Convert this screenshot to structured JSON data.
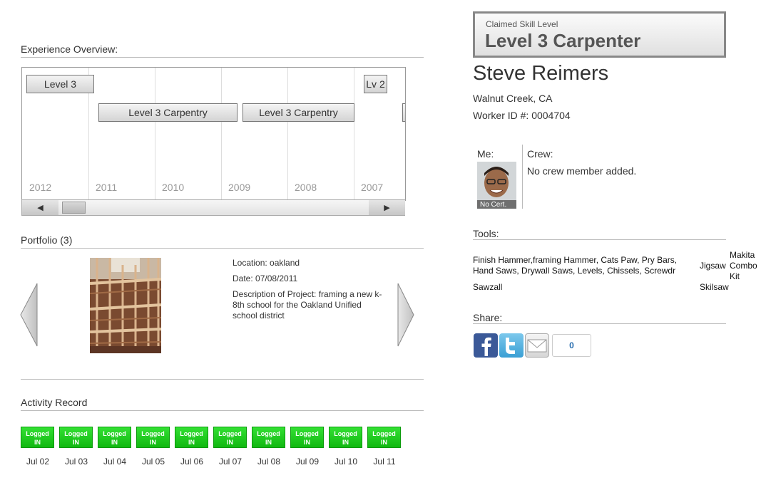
{
  "experience": {
    "title": "Experience Overview:",
    "years": [
      "2012",
      "2011",
      "2010",
      "2009",
      "2008",
      "2007"
    ],
    "bars": [
      "Level 3",
      "Level 3 Carpentry",
      "Level 3 Carpentry",
      "Lv 2"
    ],
    "scroll_left": "◀",
    "scroll_right": "▶"
  },
  "portfolio": {
    "title": "Portfolio (3)",
    "location": "Location: oakland",
    "date": "Date: 07/08/2011",
    "description": "Description of Project: framing a new k-8th school for the Oakland Unified school district"
  },
  "activity": {
    "title": "Activity Record",
    "badge_line1": "Logged",
    "badge_line2": "IN",
    "dates": [
      "Jul 02",
      "Jul 03",
      "Jul 04",
      "Jul 05",
      "Jul 06",
      "Jul 07",
      "Jul 08",
      "Jul 09",
      "Jul 10",
      "Jul 11"
    ]
  },
  "profile": {
    "skill_caption": "Claimed Skill Level",
    "skill_level": "Level 3 Carpenter",
    "name": "Steve Reimers",
    "location": "Walnut Creek, CA",
    "worker_id": "Worker ID #: 0004704",
    "me_label": "Me:",
    "no_cert": "No Cert.",
    "crew_label": "Crew:",
    "crew_text": "No crew member added."
  },
  "tools": {
    "title": "Tools:",
    "line1": "Finish Hammer,framing Hammer, Cats Paw, Pry Bars,",
    "line2": "Hand Saws, Drywall Saws, Levels, Chissels, Screwdr",
    "sawzall": "Sawzall",
    "jigsaw": "Jigsaw",
    "makita": "Makita Combo Kit",
    "skilsaw": "Skilsaw"
  },
  "share": {
    "title": "Share:",
    "count": "0"
  },
  "colors": {
    "activity_green": "#1dc41d",
    "facebook_blue": "#3b5998",
    "twitter_blue": "#4aaee0"
  }
}
